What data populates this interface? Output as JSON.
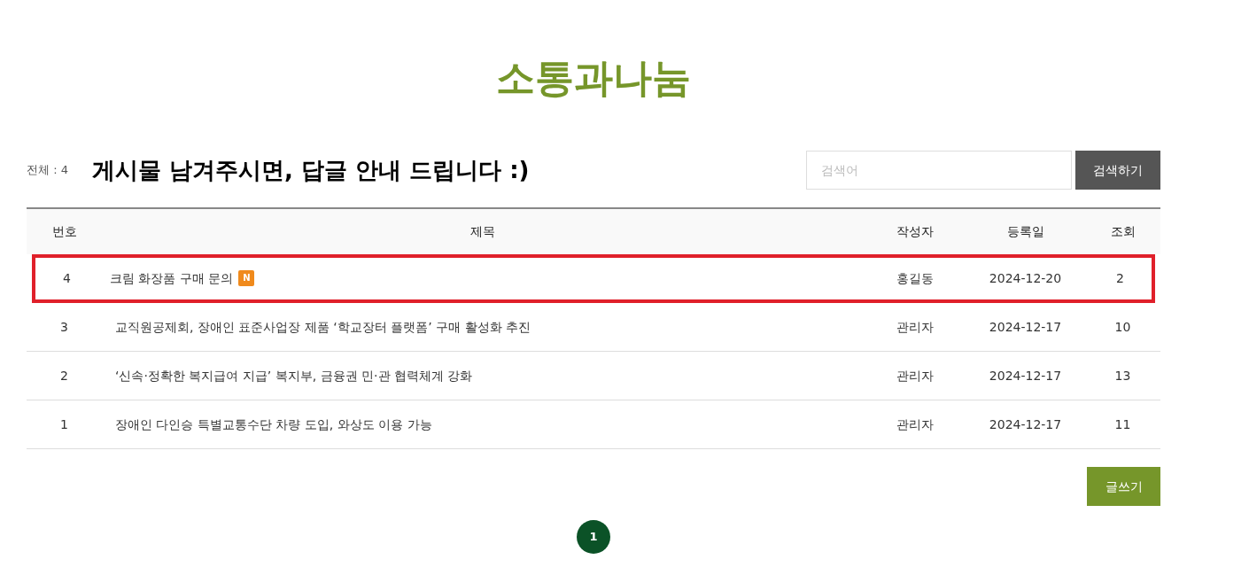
{
  "page_title": "소통과나눔",
  "total": "전체 : 4",
  "notice": "게시물 남겨주시면, 답글 안내 드립니다 :)",
  "search": {
    "placeholder": "검색어",
    "button": "검색하기"
  },
  "table": {
    "columns": [
      "번호",
      "제목",
      "작성자",
      "등록일",
      "조회"
    ],
    "rows": [
      {
        "number": "4",
        "title": "크림 화장품 구매 문의",
        "new_badge": "N",
        "author": "홍길동",
        "date": "2024-12-20",
        "views": "2",
        "highlighted": true
      },
      {
        "number": "3",
        "title": "교직원공제회, 장애인 표준사업장 제품 ‘학교장터 플랫폼’ 구매 활성화 추진",
        "author": "관리자",
        "date": "2024-12-17",
        "views": "10",
        "highlighted": false
      },
      {
        "number": "2",
        "title": "‘신속·정확한 복지급여 지급’ 복지부, 금융권 민·관 협력체계 강화",
        "author": "관리자",
        "date": "2024-12-17",
        "views": "13",
        "highlighted": false
      },
      {
        "number": "1",
        "title": "장애인 다인승 특별교통수단 차량 도입, 와상도 이용 가능",
        "author": "관리자",
        "date": "2024-12-17",
        "views": "11",
        "highlighted": false
      }
    ]
  },
  "write_button": "글쓰기",
  "pagination": [
    {
      "label": "1",
      "selected": true
    }
  ]
}
